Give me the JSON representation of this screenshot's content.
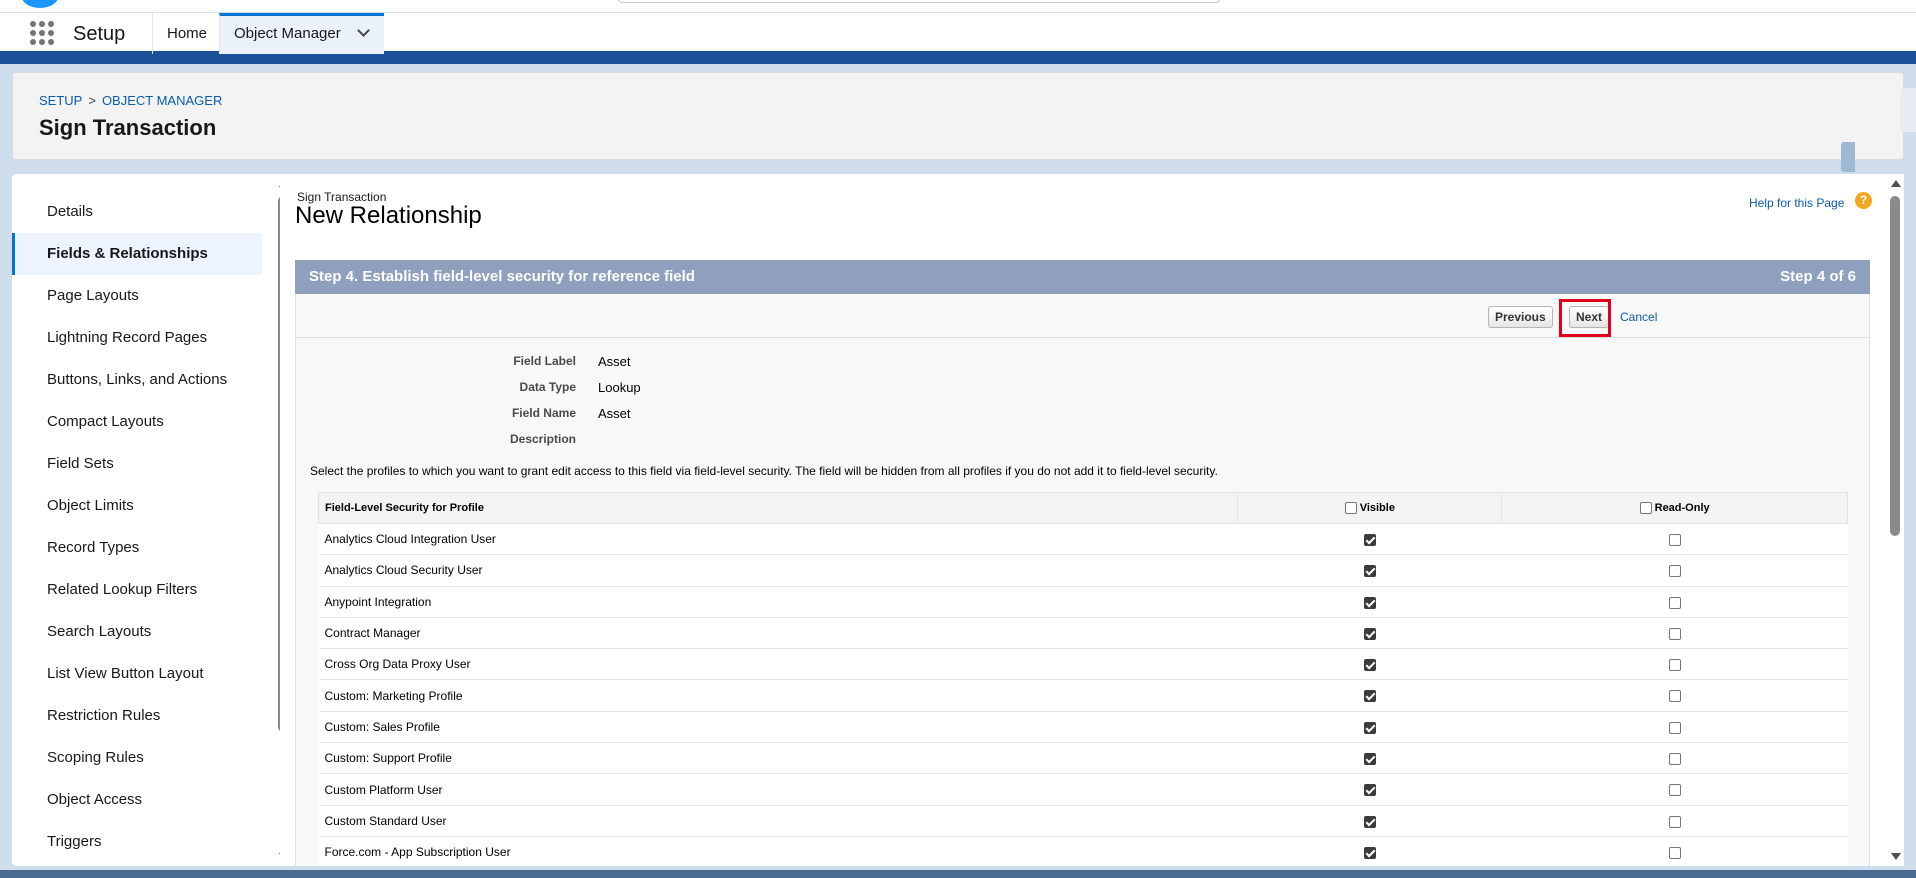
{
  "navbar": {
    "app_name": "Setup",
    "tabs": [
      {
        "label": "Home"
      },
      {
        "label": "Object Manager"
      }
    ]
  },
  "header": {
    "breadcrumb": [
      "SETUP",
      "OBJECT MANAGER"
    ],
    "title": "Sign Transaction"
  },
  "sidebar": {
    "items": [
      {
        "label": "Details",
        "active": false
      },
      {
        "label": "Fields & Relationships",
        "active": true
      },
      {
        "label": "Page Layouts",
        "active": false
      },
      {
        "label": "Lightning Record Pages",
        "active": false
      },
      {
        "label": "Buttons, Links, and Actions",
        "active": false
      },
      {
        "label": "Compact Layouts",
        "active": false
      },
      {
        "label": "Field Sets",
        "active": false
      },
      {
        "label": "Object Limits",
        "active": false
      },
      {
        "label": "Record Types",
        "active": false
      },
      {
        "label": "Related Lookup Filters",
        "active": false
      },
      {
        "label": "Search Layouts",
        "active": false
      },
      {
        "label": "List View Button Layout",
        "active": false
      },
      {
        "label": "Restriction Rules",
        "active": false
      },
      {
        "label": "Scoping Rules",
        "active": false
      },
      {
        "label": "Object Access",
        "active": false
      },
      {
        "label": "Triggers",
        "active": false
      }
    ]
  },
  "main": {
    "object_name": "Sign Transaction",
    "page_title": "New Relationship",
    "help_link": "Help for this Page",
    "help_icon_glyph": "?",
    "step_title": "Step 4. Establish field-level security for reference field",
    "step_counter": "Step 4 of 6",
    "buttons": {
      "previous": "Previous",
      "next": "Next",
      "cancel": "Cancel"
    },
    "details": [
      {
        "label": "Field Label",
        "value": "Asset"
      },
      {
        "label": "Data Type",
        "value": "Lookup"
      },
      {
        "label": "Field Name",
        "value": "Asset"
      },
      {
        "label": "Description",
        "value": ""
      }
    ],
    "instructions": "Select the profiles to which you want to grant edit access to this field via field-level security. The field will be hidden from all profiles if you do not add it to field-level security.",
    "table": {
      "headers": {
        "profile": "Field-Level Security for Profile",
        "visible": "Visible",
        "read_only": "Read-Only"
      },
      "rows": [
        {
          "profile": "Analytics Cloud Integration User",
          "visible": true,
          "read_only": false
        },
        {
          "profile": "Analytics Cloud Security User",
          "visible": true,
          "read_only": false
        },
        {
          "profile": "Anypoint Integration",
          "visible": true,
          "read_only": false
        },
        {
          "profile": "Contract Manager",
          "visible": true,
          "read_only": false
        },
        {
          "profile": "Cross Org Data Proxy User",
          "visible": true,
          "read_only": false
        },
        {
          "profile": "Custom: Marketing Profile",
          "visible": true,
          "read_only": false
        },
        {
          "profile": "Custom: Sales Profile",
          "visible": true,
          "read_only": false
        },
        {
          "profile": "Custom: Support Profile",
          "visible": true,
          "read_only": false
        },
        {
          "profile": "Custom Platform User",
          "visible": true,
          "read_only": false
        },
        {
          "profile": "Custom Standard User",
          "visible": true,
          "read_only": false
        },
        {
          "profile": "Force.com - App Subscription User",
          "visible": true,
          "read_only": false
        }
      ]
    }
  },
  "colors": {
    "brand_blue": "#1b5297",
    "link_blue": "#0b5cab",
    "step_bar": "#8ea0bd",
    "highlight_red": "#e0001b"
  }
}
